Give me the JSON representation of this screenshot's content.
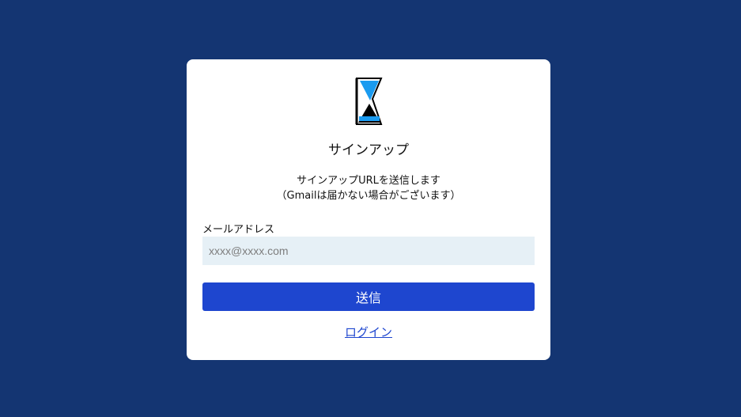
{
  "card": {
    "title": "サインアップ",
    "description_line1": "サインアップURLを送信します",
    "description_line2": "（Gmailは届かない場合がございます）",
    "email_label": "メールアドレス",
    "email_value": "",
    "email_placeholder": "xxxx@xxxx.com",
    "submit_label": "送信",
    "login_link": "ログイン"
  },
  "colors": {
    "background": "#143572",
    "card": "#ffffff",
    "button": "#1e46cf",
    "input_bg": "#e6f0f6",
    "logo_accent": "#1a9bf0"
  },
  "icons": {
    "logo": "hourglass-logo-icon"
  }
}
